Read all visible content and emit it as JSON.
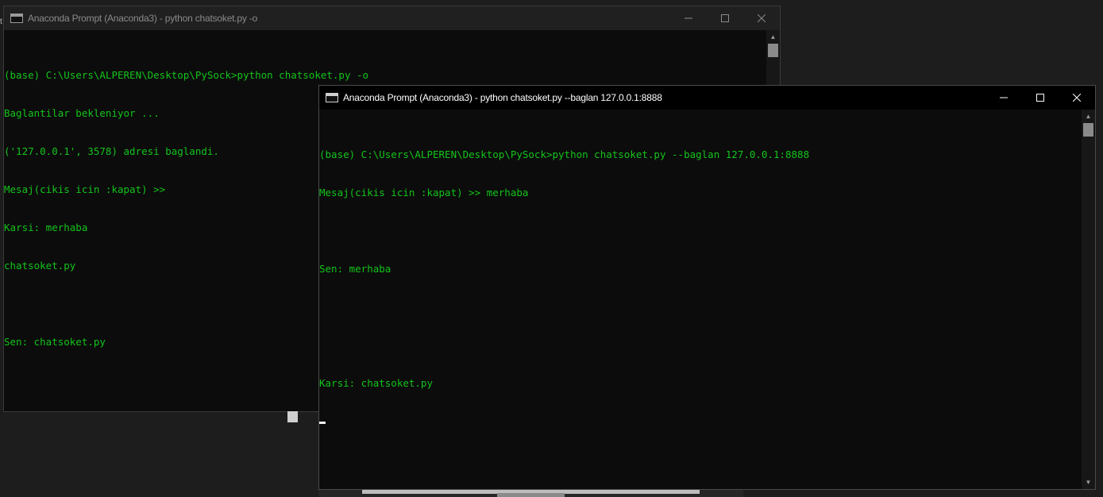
{
  "windows": {
    "back": {
      "title": "Anaconda Prompt (Anaconda3) - python  chatsoket.py -o",
      "lines": [
        "(base) C:\\Users\\ALPEREN\\Desktop\\PySock>python chatsoket.py -o",
        "Baglantilar bekleniyor ...",
        "('127.0.0.1', 3578) adresi baglandi.",
        "Mesaj(cikis icin :kapat) >>",
        "Karsi: merhaba",
        "chatsoket.py",
        "",
        "Sen: chatsoket.py"
      ]
    },
    "front": {
      "title": "Anaconda Prompt (Anaconda3) - python  chatsoket.py --baglan 127.0.0.1:8888",
      "lines": [
        "(base) C:\\Users\\ALPEREN\\Desktop\\PySock>python chatsoket.py --baglan 127.0.0.1:8888",
        "Mesaj(cikis icin :kapat) >> merhaba",
        "",
        "Sen: merhaba",
        "",
        "",
        "Karsi: chatsoket.py"
      ]
    }
  },
  "window_controls": {
    "minimize": "minimize-icon",
    "maximize": "maximize-icon",
    "close": "close-icon"
  },
  "colors": {
    "console_text": "#13c41b",
    "console_bg": "#0c0c0c",
    "titlebar_active": "#000000",
    "titlebar_inactive": "#202020"
  }
}
